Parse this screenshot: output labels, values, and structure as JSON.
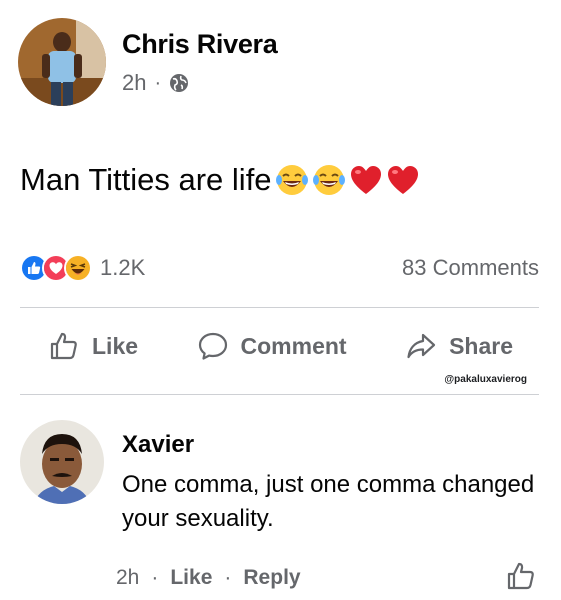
{
  "post": {
    "author": "Chris Rivera",
    "time": "2h",
    "separator": "·",
    "text": "Man Titties are life",
    "emojis": [
      "laughing-tears-emoji",
      "laughing-tears-emoji",
      "red-heart-emoji",
      "red-heart-emoji"
    ]
  },
  "reactions": {
    "icons": [
      "like-reaction-icon",
      "love-reaction-icon",
      "haha-reaction-icon"
    ],
    "count": "1.2K",
    "comments": "83 Comments"
  },
  "actions": {
    "like": "Like",
    "comment": "Comment",
    "share": "Share"
  },
  "watermark": "@pakaluxavierog",
  "comment": {
    "author": "Xavier",
    "text": "One comma, just one comma changed your sexuality.",
    "time": "2h",
    "separator": "·",
    "like": "Like",
    "reply": "Reply"
  },
  "colors": {
    "secondary_text": "#65676b",
    "like_blue": "#1877f2",
    "love_red": "#f33e58",
    "haha_yellow": "#f7b125",
    "divider": "#ced0d4"
  }
}
